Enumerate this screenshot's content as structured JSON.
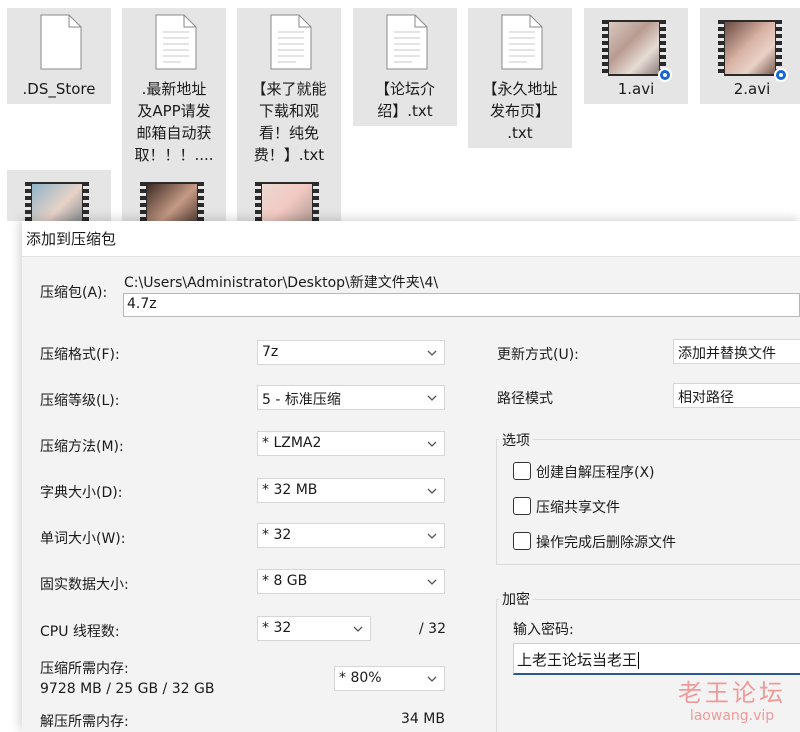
{
  "desktop": {
    "files": [
      {
        "name": ".DS_Store",
        "kind": "doc"
      },
      {
        "name": ".最新地址及APP请发邮箱自动获取！！！....",
        "kind": "doc"
      },
      {
        "name": "【来了就能下载和观看！纯免费！】.txt",
        "kind": "doc"
      },
      {
        "name": "【论坛介绍】.txt",
        "kind": "doc"
      },
      {
        "name": "【永久地址发布页】.txt",
        "kind": "doc"
      },
      {
        "name": "1.avi",
        "kind": "video"
      },
      {
        "name": "2.avi",
        "kind": "video"
      },
      {
        "name": "",
        "kind": "video"
      },
      {
        "name": "",
        "kind": "video"
      },
      {
        "name": "",
        "kind": "video"
      }
    ],
    "file_names": {
      "f0": ".DS_Store",
      "f1_l1": ".最新地址",
      "f1_l2": "及APP请发",
      "f1_l3": "邮箱自动获",
      "f1_l4": "取！！！....",
      "f2_l1": "【来了就能",
      "f2_l2": "下载和观",
      "f2_l3": "看！纯免",
      "f2_l4": "费！】.txt",
      "f3_l1": "【论坛介",
      "f3_l2": "绍】.txt",
      "f4_l1": "【永久地址",
      "f4_l2": "发布页】",
      "f4_l3": ".txt",
      "f5": "1.avi",
      "f6": "2.avi"
    }
  },
  "dialog": {
    "title": "添加到压缩包",
    "archive_label": "压缩包(A):",
    "archive_path": "C:\\Users\\Administrator\\Desktop\\新建文件夹\\4\\",
    "archive_name": "4.7z",
    "left": {
      "format_label": "压缩格式(F):",
      "format_value": "7z",
      "level_label": "压缩等级(L):",
      "level_value": "5 - 标准压缩",
      "method_label": "压缩方法(M):",
      "method_value": "*  LZMA2",
      "dict_label": "字典大小(D):",
      "dict_value": "*  32 MB",
      "word_label": "单词大小(W):",
      "word_value": "*  32",
      "solid_label": "固实数据大小:",
      "solid_value": "*  8 GB",
      "cpu_label": "CPU 线程数:",
      "cpu_value": "*  32",
      "cpu_max": "/ 32",
      "mem_label": "压缩所需内存:",
      "mem_detail": "9728 MB / 25 GB / 32 GB",
      "mem_value": "*  80%",
      "decomp_label": "解压所需内存:",
      "decomp_value": "34 MB"
    },
    "right": {
      "update_label": "更新方式(U):",
      "update_value": "添加并替换文件",
      "path_label": "路径模式",
      "path_value": "相对路径",
      "options_title": "选项",
      "opt_sfx": "创建自解压程序(X)",
      "opt_shared": "压缩共享文件",
      "opt_delete": "操作完成后删除源文件",
      "encrypt_title": "加密",
      "password_label": "输入密码:",
      "password_value": "上老王论坛当老王"
    }
  },
  "watermark": {
    "site": "老王论坛",
    "url": "laowang.vip"
  },
  "colors": {
    "tile": "#e5e5e5",
    "dialog_bg": "#f3f3f3",
    "accent": "#2b579a",
    "watermark": "#f09a9a",
    "badge": "#1565d8"
  }
}
